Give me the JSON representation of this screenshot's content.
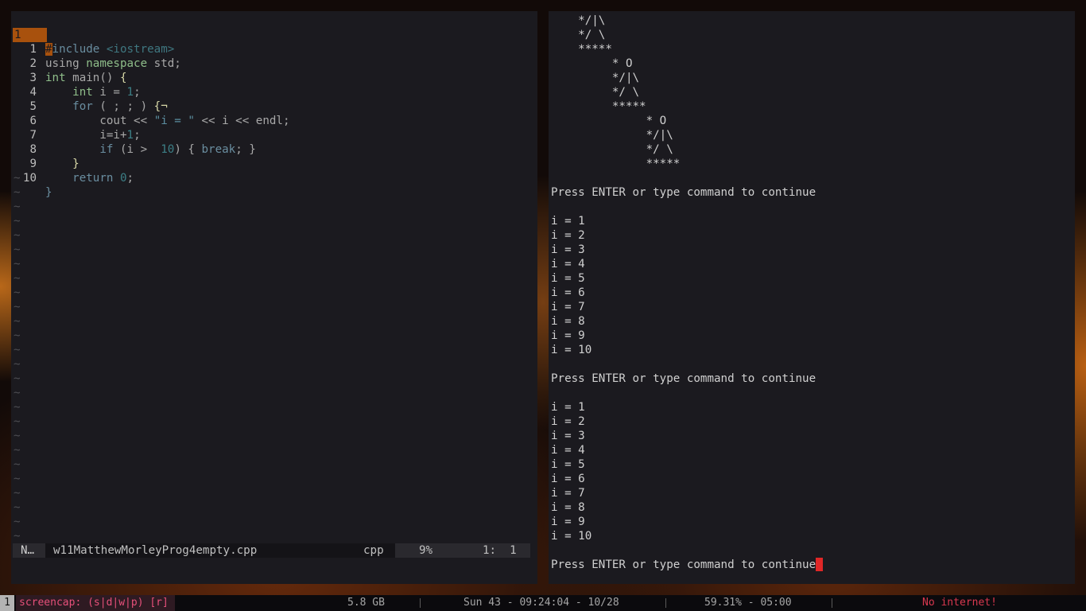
{
  "editor": {
    "lines": [
      {
        "num": "1",
        "current": true
      },
      {
        "num": "1"
      },
      {
        "num": "2"
      },
      {
        "num": "3"
      },
      {
        "num": "4"
      },
      {
        "num": "5"
      },
      {
        "num": "6"
      },
      {
        "num": "7"
      },
      {
        "num": "8"
      },
      {
        "num": "9"
      },
      {
        "num": "10"
      }
    ],
    "code": {
      "l0_hash": "#",
      "l0_include": "include",
      "l0_header": "<iostream>",
      "l1_using": "using",
      "l1_namespace": "namespace",
      "l1_rest": " std;",
      "l2_int": "int",
      "l2_rest": " main() ",
      "l2_brace": "{",
      "l3_indent": "    ",
      "l3_int": "int",
      "l3_rest": " i = ",
      "l3_num": "1",
      "l3_end": ";",
      "l4_indent": "    ",
      "l4_for": "for",
      "l4_rest": " ( ; ; ) ",
      "l4_brace": "{¬",
      "l5_indent": "        ",
      "l5_a": "cout << ",
      "l5_str": "\"i = \"",
      "l5_b": " << i << endl;",
      "l6_indent": "        ",
      "l6_a": "i=i+",
      "l6_num": "1",
      "l6_end": ";",
      "l7_indent": "        ",
      "l7_if": "if",
      "l7_a": " (i >  ",
      "l7_num": "10",
      "l7_b": ") { ",
      "l7_break": "break",
      "l7_c": "; }",
      "l8_indent": "    ",
      "l8_brace": "}",
      "l9_indent": "    ",
      "l9_return": "return",
      "l9_sp": " ",
      "l9_num": "0",
      "l9_end": ";",
      "l10_brace": "}"
    },
    "tilde": "~",
    "status": {
      "mode": "N…",
      "filename": "w11MatthewMorleyProg4empty.cpp",
      "filetype": "cpp",
      "percent": "9%",
      "position": "1:  1"
    }
  },
  "terminal": {
    "lines": [
      "    */|\\",
      "    */ \\",
      "    *****",
      "         * O",
      "         */|\\",
      "         */ \\",
      "         *****",
      "              * O",
      "              */|\\",
      "              */ \\",
      "              *****",
      "",
      "Press ENTER or type command to continue",
      "",
      "i = 1",
      "i = 2",
      "i = 3",
      "i = 4",
      "i = 5",
      "i = 6",
      "i = 7",
      "i = 8",
      "i = 9",
      "i = 10",
      "",
      "Press ENTER or type command to continue",
      "",
      "i = 1",
      "i = 2",
      "i = 3",
      "i = 4",
      "i = 5",
      "i = 6",
      "i = 7",
      "i = 8",
      "i = 9",
      "i = 10",
      "",
      "Press ENTER or type command to continue"
    ]
  },
  "bar": {
    "workspace": "1",
    "title": "screencap: (s|d|w|p) [r]",
    "memory": "5.8 GB",
    "clock": "Sun 43 - 09:24:04 - 10/28",
    "battery": "59.31% - 05:00",
    "network": "No internet!"
  },
  "colors": {
    "accent": "#a8510d",
    "cursor": "#e02727",
    "network_warning": "#d9384f",
    "workspace_title": "#e6507a"
  }
}
